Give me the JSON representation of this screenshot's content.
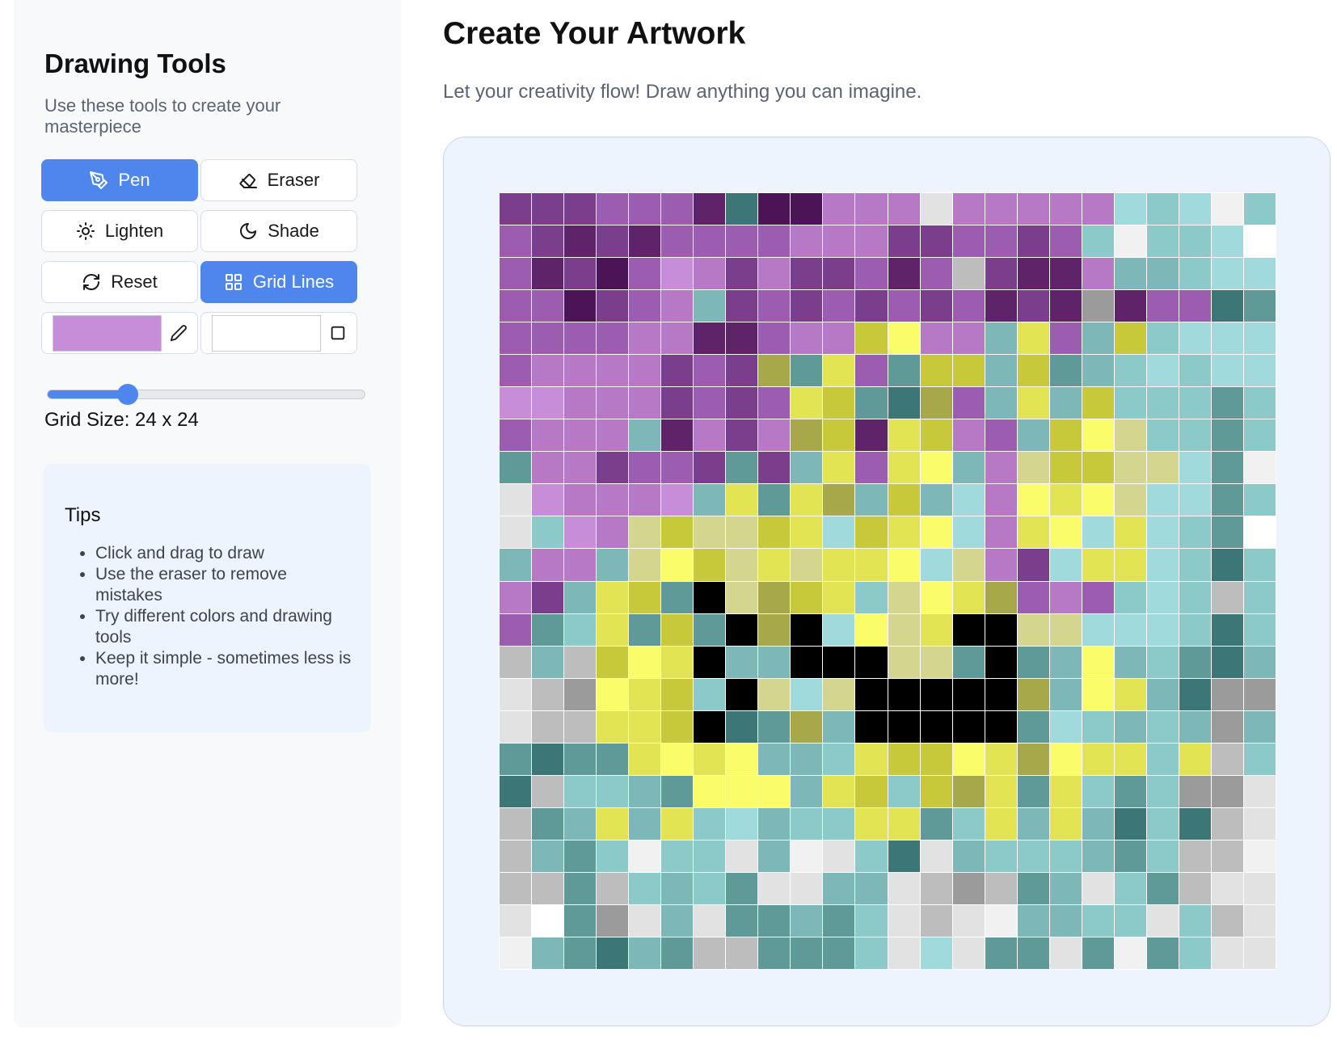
{
  "sidebar": {
    "title": "Drawing Tools",
    "subtitle": "Use these tools to create your masterpiece",
    "tools": {
      "pen": "Pen",
      "eraser": "Eraser",
      "lighten": "Lighten",
      "shade": "Shade",
      "reset": "Reset",
      "grid_lines": "Grid Lines"
    },
    "active_tools": [
      "pen",
      "grid_lines"
    ],
    "primary_color": "#c88dd8",
    "secondary_color": "#ffffff",
    "grid_size_label": "Grid Size: 24 x 24",
    "grid_size_slider_fraction": 0.25,
    "tips": {
      "title": "Tips",
      "items": [
        "Click and drag to draw",
        "Use the eraser to remove mistakes",
        "Try different colors and drawing tools",
        "Keep it simple - sometimes less is more!"
      ]
    }
  },
  "main": {
    "title": "Create Your Artwork",
    "subtitle": "Let your creativity flow! Draw anything you can imagine."
  },
  "colors": {
    "accent": "#4f86ee",
    "card_background": "#eef4fd",
    "sidebar_background": "#f8f9fb"
  },
  "canvas": {
    "rows": 24,
    "cols": 24,
    "palette": {
      "P": "#9c5cb0",
      "p": "#7b3e8c",
      "D": "#5e2369",
      "d": "#4a1456",
      "L": "#b778c5",
      "l": "#c88dd8",
      "Y": "#e2e454",
      "y": "#c7c93b",
      "o": "#a6a84a",
      "F": "#fbfc6a",
      "C": "#d4d58e",
      "T": "#5f9a98",
      "t": "#7db7b7",
      "A": "#a1dadd",
      "a": "#8ccaca",
      "E": "#3d7676",
      "K": "#000000",
      "G": "#bdbdbd",
      "g": "#e2e2e2",
      "H": "#9b9b9b",
      "W": "#ffffff",
      "S": "#f1f1f1"
    },
    "pixels": [
      "pppPPPDEddLLLgLLLLLAaASa",
      "PpDpDPPPPLLLppPPpPaSaaAW",
      "PDpdPlLpLppPDPGpDDLttaAA",
      "PPdpPLtpPpPpPpPDpDHDPPET",
      "PPPPLLDDPLLyFLLtYPtyaAAA",
      "PLLLLpPpoTYPTyytyTtaAaAA",
      "llLLLpPpPYyTEoPtYtyaaaTa",
      "PLLLtDLpLoyDYyLPtyFCaaTa",
      "TLLpPPpTptYPYFtLCyyCCATS",
      "glLLLltYTYotytALFYFCAATa",
      "galLCyCCyYAyYFALYFAYAaTW",
      "tLLtCFyCYCYYFACLpAYYAaEa",
      "LptYyTKCoyYaCFYoPLPaAaGa",
      "PTaYTyTKoKAFCYKKCCAAAaEa",
      "GtGyFYKttKKKCCTKTtFtaTEt",
      "gGHFYyaKCACKKKKKotFYtEHH",
      "gGGYYyKETotKKKKKTAatatHt",
      "TETTYFYFttaYyyFYoFYYaYGa",
      "EGaatTFFFtYyayoYTYaTaHHg",
      "GTtYtYaAtaaYYTaYtYtEaEGg",
      "GtTaSaagtSgaEgtaaatTaGGS",
      "GGTGataTggttgGHGTtgaTGgg",
      "gWTHgtgTTtTagGgSttaagaGg",
      "StTEtTGGTTTagAgTTgTSTagg"
    ]
  }
}
